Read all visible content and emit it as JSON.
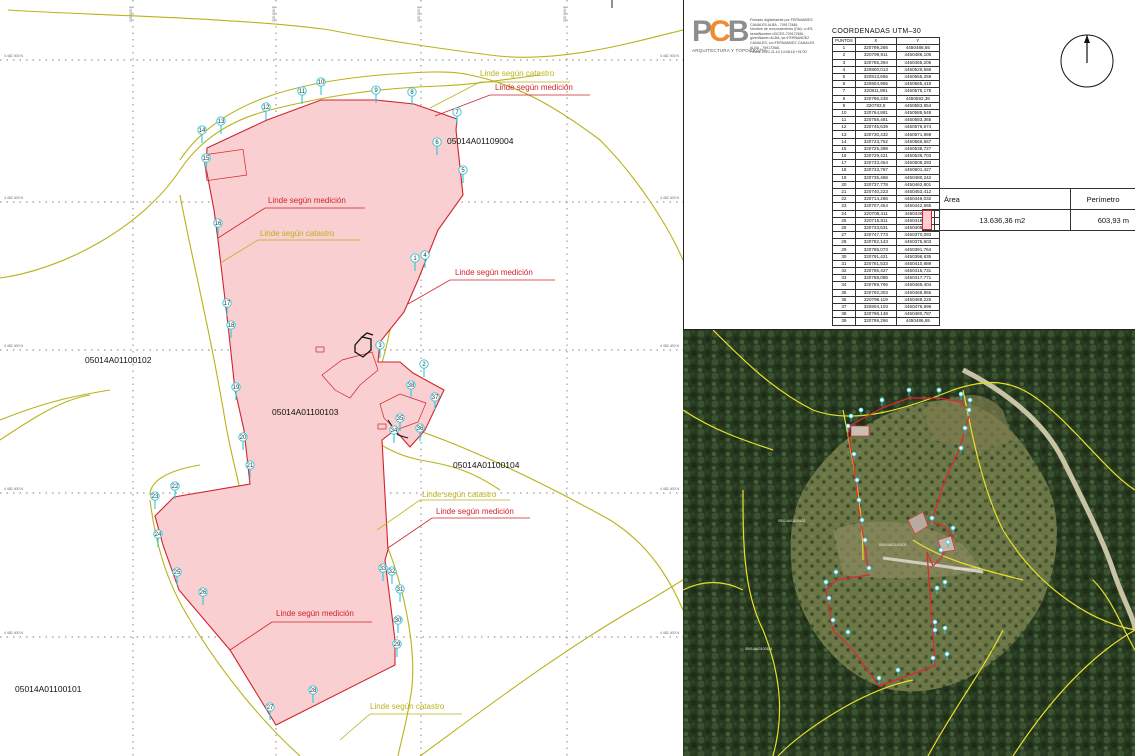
{
  "plan": {
    "parcels": {
      "p102": "05014A01100102",
      "p103": "05014A01100103",
      "p104": "05014A01100104",
      "p101": "05014A01100101",
      "p9004": "05014A01109004"
    },
    "linde_catastro": "Linde según catastro",
    "linde_medicion": "Linde según medición",
    "grid_label": "4 482 400 N",
    "grid_label_x": "320 600 E",
    "points": [
      "1",
      "2",
      "3",
      "4",
      "5",
      "6",
      "7",
      "8",
      "9",
      "10",
      "11",
      "12",
      "13",
      "14",
      "15",
      "16",
      "17",
      "18",
      "19",
      "20",
      "21",
      "22",
      "23",
      "24",
      "25",
      "26",
      "27",
      "28",
      "29",
      "30",
      "31",
      "32",
      "33",
      "34",
      "35",
      "36",
      "37",
      "38"
    ]
  },
  "info": {
    "logo_text": "PCB",
    "logo_subtitle": "ARQUITECTURA Y TOPOGRAFIA",
    "signature_lines": [
      "Firmado digitalmente por FERNANDEZ",
      "CANALES ALBA - 70917268L",
      "Nombre de reconocimiento (DN): c=ES,",
      "serialNumber=IDCES-70917268L,",
      "givenName=ALBA, sn=FERNANDEZ",
      "CANALES, cn=FERNANDEZ CANALES",
      "ALBA - 70917268L",
      "Fecha: 2021.11.10 14:08:18 +01'00'"
    ],
    "coords_title": "COORDENADAS   UTM–30",
    "coords_headers": [
      "PUNTOS",
      "X",
      "Y"
    ],
    "coords_rows": [
      [
        "1",
        "320799,266",
        "4450488,65"
      ],
      [
        "2",
        "320799,911",
        "4450486,105"
      ],
      [
        "3",
        "320785,394",
        "4450465,205"
      ],
      [
        "4",
        "320800,013",
        "4450525,568"
      ],
      [
        "5",
        "320813,655",
        "4450555,259"
      ],
      [
        "6",
        "320804,955",
        "4450565,418"
      ],
      [
        "7",
        "320811,891",
        "4450575,178"
      ],
      [
        "8",
        "320796,248",
        "4450582,36"
      ],
      [
        "9",
        "320783,8",
        "4450583,854"
      ],
      [
        "10",
        "320764,881",
        "4450585,548"
      ],
      [
        "11",
        "320758,481",
        "4450583,365"
      ],
      [
        "12",
        "320745,639",
        "4450576,674"
      ],
      [
        "13",
        "320730,432",
        "4450571,969"
      ],
      [
        "14",
        "320723,752",
        "4450566,657"
      ],
      [
        "15",
        "320725,398",
        "4450538,727"
      ],
      [
        "16",
        "320729,421",
        "4450536,703"
      ],
      [
        "17",
        "320733,454",
        "4450509,293"
      ],
      [
        "18",
        "320733,787",
        "4450501,427"
      ],
      [
        "19",
        "320735,466",
        "4450480,242"
      ],
      [
        "20",
        "320737,778",
        "4450462,801"
      ],
      [
        "21",
        "320740,223",
        "4450453,412"
      ],
      [
        "22",
        "320714,266",
        "4450446,032"
      ],
      [
        "23",
        "320707,454",
        "4450442,565"
      ],
      [
        "24",
        "320708,411",
        "4450426,511"
      ],
      [
        "25",
        "320715,811",
        "4450418,613"
      ],
      [
        "26",
        "320733,631",
        "4450408,003"
      ],
      [
        "27",
        "320747,773",
        "4450370,093"
      ],
      [
        "28",
        "320782,143",
        "4450375,603"
      ],
      [
        "29",
        "320785,073",
        "4450391,764"
      ],
      [
        "30",
        "320791,421",
        "4450396,835"
      ],
      [
        "31",
        "320781,533",
        "4450410,889"
      ],
      [
        "32",
        "320786,427",
        "4450415,731"
      ],
      [
        "33",
        "320788,085",
        "4450417,771"
      ],
      [
        "34",
        "320789,766",
        "4450465,404"
      ],
      [
        "35",
        "320792,303",
        "4450468,856"
      ],
      [
        "36",
        "320798,119",
        "4450468,226"
      ],
      [
        "37",
        "320804,103",
        "4450476,698"
      ],
      [
        "38",
        "320798,148",
        "4450480,787"
      ],
      [
        "39",
        "320799,266",
        "4450486,65"
      ]
    ],
    "area_header": "Área",
    "perimeter_header": "Perímetro",
    "area_value": "13.636,36 m2",
    "perimeter_value": "603,93 m"
  },
  "colors": {
    "parcel_fill": "#f9cfd1",
    "measured_line": "#d0232a",
    "cadastral_line": "#b9b21a",
    "point_marker": "#2ec8d6",
    "logo_orange": "#f28a2e"
  },
  "icons": [
    "north-arrow-icon",
    "logo-icon"
  ]
}
